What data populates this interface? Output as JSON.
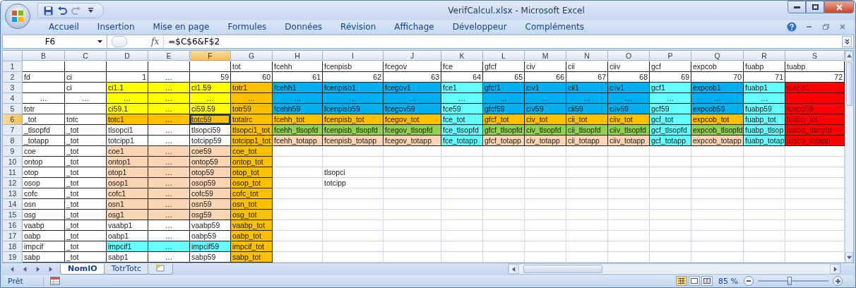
{
  "window": {
    "title": "VerifCalcul.xlsx - Microsoft Excel"
  },
  "ribbon_tabs": [
    {
      "label": "Accueil",
      "selected": false
    },
    {
      "label": "Insertion",
      "selected": false
    },
    {
      "label": "Mise en page",
      "selected": false
    },
    {
      "label": "Formules",
      "selected": false
    },
    {
      "label": "Données",
      "selected": false
    },
    {
      "label": "Révision",
      "selected": false
    },
    {
      "label": "Affichage",
      "selected": false
    },
    {
      "label": "Développeur",
      "selected": false
    },
    {
      "label": "Compléments",
      "selected": false
    }
  ],
  "formula_bar": {
    "name_box": "F6",
    "function_label": "fx",
    "formula": "=$C$6&F$2"
  },
  "grid": {
    "columns": [
      {
        "label": "B",
        "selected": false
      },
      {
        "label": "C",
        "selected": false
      },
      {
        "label": "D",
        "selected": false
      },
      {
        "label": "E",
        "selected": false
      },
      {
        "label": "F",
        "selected": true
      },
      {
        "label": "G",
        "selected": false
      },
      {
        "label": "H",
        "selected": false
      },
      {
        "label": "I",
        "selected": false
      },
      {
        "label": "J",
        "selected": false
      },
      {
        "label": "K",
        "selected": false
      },
      {
        "label": "L",
        "selected": false
      },
      {
        "label": "M",
        "selected": false
      },
      {
        "label": "N",
        "selected": false
      },
      {
        "label": "O",
        "selected": false
      },
      {
        "label": "P",
        "selected": false
      },
      {
        "label": "Q",
        "selected": false
      },
      {
        "label": "R",
        "selected": false
      },
      {
        "label": "S",
        "selected": false
      }
    ],
    "rows": [
      {
        "number": "1",
        "selected": false,
        "cells": [
          {
            "kind": "label"
          },
          {
            "kind": "label"
          },
          {
            "kind": "label"
          },
          {
            "kind": "label"
          },
          {
            "kind": "label"
          },
          {
            "kind": "label",
            "text": "tot"
          },
          {
            "kind": "label",
            "text": "fcehh"
          },
          {
            "kind": "label",
            "text": "fcenpisb"
          },
          {
            "kind": "label",
            "text": "fcegov"
          },
          {
            "kind": "label",
            "text": "fce"
          },
          {
            "kind": "label",
            "text": "gfcf"
          },
          {
            "kind": "label",
            "text": "civ"
          },
          {
            "kind": "label",
            "text": "cii"
          },
          {
            "kind": "label",
            "text": "ciiv"
          },
          {
            "kind": "label",
            "text": "gcf"
          },
          {
            "kind": "label",
            "text": "expcob"
          },
          {
            "kind": "label",
            "text": "fuabp"
          },
          {
            "kind": "label",
            "text": "tuabp"
          }
        ]
      },
      {
        "number": "2",
        "selected": false,
        "cells": [
          {
            "kind": "label",
            "text": "fd"
          },
          {
            "kind": "label",
            "text": "ci"
          },
          {
            "kind": "number",
            "text": "1"
          },
          {
            "kind": "ellipsis",
            "text": "…"
          },
          {
            "kind": "number",
            "text": "59"
          },
          {
            "kind": "number",
            "text": "60"
          },
          {
            "kind": "number",
            "text": "61"
          },
          {
            "kind": "number",
            "text": "62"
          },
          {
            "kind": "number",
            "text": "63"
          },
          {
            "kind": "number",
            "text": "64"
          },
          {
            "kind": "number",
            "text": "65"
          },
          {
            "kind": "number",
            "text": "66"
          },
          {
            "kind": "number",
            "text": "67"
          },
          {
            "kind": "number",
            "text": "68"
          },
          {
            "kind": "number",
            "text": "69"
          },
          {
            "kind": "number",
            "text": "70"
          },
          {
            "kind": "number",
            "text": "71"
          },
          {
            "kind": "number",
            "text": "72"
          }
        ]
      },
      {
        "number": "3",
        "selected": false,
        "cells": [
          {
            "kind": "label"
          },
          {
            "kind": "label",
            "text": "ci"
          },
          {
            "kind": "label",
            "text": "ci1.1",
            "color": "#ffff00"
          },
          {
            "kind": "ellipsis",
            "text": "…",
            "color": "#ffff00"
          },
          {
            "kind": "label",
            "text": "ci1.59",
            "color": "#ffff00"
          },
          {
            "kind": "label",
            "text": "totr1",
            "color": "#ffc000"
          },
          {
            "kind": "label",
            "text": "fcehh1",
            "color": "#00b0f0"
          },
          {
            "kind": "label",
            "text": "fcenpisb1",
            "color": "#00b0f0"
          },
          {
            "kind": "label",
            "text": "fcegov1",
            "color": "#00b0f0"
          },
          {
            "kind": "label",
            "text": "fce1",
            "color": "#66ffff"
          },
          {
            "kind": "label",
            "text": "gfcf1",
            "color": "#00b0f0"
          },
          {
            "kind": "label",
            "text": "civ1",
            "color": "#00b0f0"
          },
          {
            "kind": "label",
            "text": "cii1",
            "color": "#00b0f0"
          },
          {
            "kind": "label",
            "text": "ciiv1",
            "color": "#00b0f0"
          },
          {
            "kind": "label",
            "text": "gcf1",
            "color": "#66ffff"
          },
          {
            "kind": "label",
            "text": "expcob1",
            "color": "#00b0f0"
          },
          {
            "kind": "label",
            "text": "fuabp1",
            "color": "#66ffff"
          },
          {
            "kind": "label",
            "text": "tuabp1",
            "color": "#ff0000"
          }
        ]
      },
      {
        "number": "4",
        "selected": false,
        "cells": [
          {
            "kind": "ellipsis",
            "text": "…"
          },
          {
            "kind": "ellipsis",
            "text": "…"
          },
          {
            "kind": "ellipsis",
            "text": "…",
            "color": "#ffff00"
          },
          {
            "kind": "ellipsis",
            "text": "…",
            "color": "#ffff00"
          },
          {
            "kind": "ellipsis",
            "text": "…",
            "color": "#ffff00"
          },
          {
            "kind": "ellipsis",
            "text": "…",
            "color": "#ffc000"
          },
          {
            "kind": "ellipsis",
            "text": "…",
            "color": "#00b0f0"
          },
          {
            "kind": "ellipsis",
            "text": "…",
            "color": "#00b0f0"
          },
          {
            "kind": "ellipsis",
            "text": "…",
            "color": "#00b0f0"
          },
          {
            "kind": "ellipsis",
            "text": "…",
            "color": "#66ffff"
          },
          {
            "kind": "ellipsis",
            "text": "…",
            "color": "#00b0f0"
          },
          {
            "kind": "ellipsis",
            "text": "…",
            "color": "#00b0f0"
          },
          {
            "kind": "ellipsis",
            "text": "…",
            "color": "#00b0f0"
          },
          {
            "kind": "ellipsis",
            "text": "…",
            "color": "#00b0f0"
          },
          {
            "kind": "ellipsis",
            "text": "…",
            "color": "#66ffff"
          },
          {
            "kind": "ellipsis",
            "text": "…",
            "color": "#00b0f0"
          },
          {
            "kind": "ellipsis",
            "text": "…",
            "color": "#66ffff"
          },
          {
            "kind": "ellipsis",
            "text": "…",
            "color": "#ff0000"
          }
        ]
      },
      {
        "number": "5",
        "selected": false,
        "cells": [
          {
            "kind": "label",
            "text": "totr"
          },
          {
            "kind": "label"
          },
          {
            "kind": "label",
            "text": "ci59.1",
            "color": "#ffff00"
          },
          {
            "kind": "ellipsis",
            "text": "…",
            "color": "#ffff00"
          },
          {
            "kind": "label",
            "text": "ci59.59",
            "color": "#ffff00"
          },
          {
            "kind": "label",
            "text": "totr59",
            "color": "#ffc000"
          },
          {
            "kind": "label",
            "text": "fcehh59",
            "color": "#00b0f0"
          },
          {
            "kind": "label",
            "text": "fcenpisb59",
            "color": "#00b0f0"
          },
          {
            "kind": "label",
            "text": "fcegov59",
            "color": "#00b0f0"
          },
          {
            "kind": "label",
            "text": "fce59",
            "color": "#66ffff"
          },
          {
            "kind": "label",
            "text": "gfcf59",
            "color": "#00b0f0"
          },
          {
            "kind": "label",
            "text": "civ59",
            "color": "#00b0f0"
          },
          {
            "kind": "label",
            "text": "cii59",
            "color": "#00b0f0"
          },
          {
            "kind": "label",
            "text": "ciiv59",
            "color": "#00b0f0"
          },
          {
            "kind": "label",
            "text": "gcf59",
            "color": "#66ffff"
          },
          {
            "kind": "label",
            "text": "expcob59",
            "color": "#00b0f0"
          },
          {
            "kind": "label",
            "text": "fuabp59",
            "color": "#66ffff"
          },
          {
            "kind": "label",
            "text": "tuabp59",
            "color": "#ff0000"
          }
        ]
      },
      {
        "number": "6",
        "selected": true,
        "cells": [
          {
            "kind": "label",
            "text": "_tot"
          },
          {
            "kind": "label",
            "text": "totc"
          },
          {
            "kind": "label",
            "text": "totc1",
            "color": "#ffc000"
          },
          {
            "kind": "ellipsis",
            "text": "…",
            "color": "#ffc000"
          },
          {
            "kind": "label",
            "text": "totc59",
            "color": "#ffc000"
          },
          {
            "kind": "label",
            "text": "totalrc",
            "color": "#ffc000"
          },
          {
            "kind": "label",
            "text": "fcehh_tot",
            "color": "#ffc000"
          },
          {
            "kind": "label",
            "text": "fcenpisb_tot",
            "color": "#ffc000"
          },
          {
            "kind": "label",
            "text": "fcegov_tot",
            "color": "#ffc000"
          },
          {
            "kind": "label",
            "text": "fce_tot",
            "color": "#66ffff"
          },
          {
            "kind": "label",
            "text": "gfcf_tot",
            "color": "#ffc000"
          },
          {
            "kind": "label",
            "text": "civ_tot",
            "color": "#ffc000"
          },
          {
            "kind": "label",
            "text": "cii_tot",
            "color": "#ffc000"
          },
          {
            "kind": "label",
            "text": "ciiv_tot",
            "color": "#ffc000"
          },
          {
            "kind": "label",
            "text": "gcf_tot",
            "color": "#66ffff"
          },
          {
            "kind": "label",
            "text": "expcob_tot",
            "color": "#ffc000"
          },
          {
            "kind": "label",
            "text": "fuabp_tot",
            "color": "#66ffff"
          },
          {
            "kind": "label",
            "text": "tuabp_tot",
            "color": "#ff0000"
          }
        ]
      },
      {
        "number": "7",
        "selected": false,
        "cells": [
          {
            "kind": "label",
            "text": "_tlsopfd"
          },
          {
            "kind": "label",
            "text": "_tot"
          },
          {
            "kind": "label",
            "text": "tlsopci1"
          },
          {
            "kind": "ellipsis",
            "text": "…"
          },
          {
            "kind": "label",
            "text": "tlsopci59"
          },
          {
            "kind": "label",
            "text": "tlsopci1_tot",
            "color": "#ffc000"
          },
          {
            "kind": "label",
            "text": "fcehh_tlsopfd",
            "color": "#92d050"
          },
          {
            "kind": "label",
            "text": "fcenpisb_tlsopfd",
            "color": "#92d050"
          },
          {
            "kind": "label",
            "text": "fcegov_tlsopfd",
            "color": "#92d050"
          },
          {
            "kind": "label",
            "text": "fce_tlsopfd",
            "color": "#66ffff"
          },
          {
            "kind": "label",
            "text": "gfcf_tlsopfd",
            "color": "#92d050"
          },
          {
            "kind": "label",
            "text": "civ_tlsopfd",
            "color": "#92d050"
          },
          {
            "kind": "label",
            "text": "cii_tlsopfd",
            "color": "#92d050"
          },
          {
            "kind": "label",
            "text": "ciiv_tlsopfd",
            "color": "#92d050"
          },
          {
            "kind": "label",
            "text": "gcf_tlsopfd",
            "color": "#66ffff"
          },
          {
            "kind": "label",
            "text": "expcob_tlsopfd",
            "color": "#92d050"
          },
          {
            "kind": "label",
            "text": "fuabp_tlsop",
            "color": "#66ffff"
          },
          {
            "kind": "label",
            "text": "tuabp_tlsopfd",
            "color": "#ff0000"
          }
        ]
      },
      {
        "number": "8",
        "selected": false,
        "cells": [
          {
            "kind": "label",
            "text": "_totapp"
          },
          {
            "kind": "label",
            "text": "_tot"
          },
          {
            "kind": "label",
            "text": "totcipp1"
          },
          {
            "kind": "ellipsis",
            "text": "…"
          },
          {
            "kind": "label",
            "text": "totcipp59"
          },
          {
            "kind": "label",
            "text": "totcipp1_tot",
            "color": "#ffc000"
          },
          {
            "kind": "label",
            "text": "fcehh_totapp",
            "color": "#fcd5b4"
          },
          {
            "kind": "label",
            "text": "fcenpisb_totapp",
            "color": "#fcd5b4"
          },
          {
            "kind": "label",
            "text": "fcegov_totapp",
            "color": "#fcd5b4"
          },
          {
            "kind": "label",
            "text": "fce_totapp",
            "color": "#66ffff"
          },
          {
            "kind": "label",
            "text": "gfcf_totapp",
            "color": "#fcd5b4"
          },
          {
            "kind": "label",
            "text": "civ_totapp",
            "color": "#fcd5b4"
          },
          {
            "kind": "label",
            "text": "cii_totapp",
            "color": "#fcd5b4"
          },
          {
            "kind": "label",
            "text": "ciiv_totapp",
            "color": "#fcd5b4"
          },
          {
            "kind": "label",
            "text": "gcf_totapp",
            "color": "#66ffff"
          },
          {
            "kind": "label",
            "text": "expcob_totapp",
            "color": "#fcd5b4"
          },
          {
            "kind": "label",
            "text": "fuabp_totap",
            "color": "#66ffff"
          },
          {
            "kind": "label",
            "text": "tuabp_totapp",
            "color": "#ff0000"
          }
        ]
      },
      {
        "number": "9",
        "selected": false,
        "cells": [
          {
            "kind": "label",
            "text": "coe"
          },
          {
            "kind": "label",
            "text": "_tot"
          },
          {
            "kind": "label",
            "text": "coe1",
            "color": "#fcd5b4"
          },
          {
            "kind": "ellipsis",
            "text": "…",
            "color": "#fcd5b4"
          },
          {
            "kind": "label",
            "text": "coe59",
            "color": "#fcd5b4"
          },
          {
            "kind": "label",
            "text": "coe_tot",
            "color": "#ffc000"
          },
          {
            "kind": "loose"
          },
          {
            "kind": "loose"
          },
          {
            "kind": "loose"
          },
          {
            "kind": "loose"
          },
          {
            "kind": "loose"
          },
          {
            "kind": "loose"
          },
          {
            "kind": "loose"
          },
          {
            "kind": "loose"
          },
          {
            "kind": "loose"
          },
          {
            "kind": "loose"
          },
          {
            "kind": "loose"
          },
          {
            "kind": "loose"
          }
        ]
      },
      {
        "number": "10",
        "selected": false,
        "cells": [
          {
            "kind": "label",
            "text": "ontop"
          },
          {
            "kind": "label",
            "text": "_tot"
          },
          {
            "kind": "label",
            "text": "ontop1",
            "color": "#fcd5b4"
          },
          {
            "kind": "ellipsis",
            "text": "…",
            "color": "#fcd5b4"
          },
          {
            "kind": "label",
            "text": "ontop59",
            "color": "#fcd5b4"
          },
          {
            "kind": "label",
            "text": "ontop_tot",
            "color": "#ffc000"
          },
          {
            "kind": "loose"
          },
          {
            "kind": "loose"
          },
          {
            "kind": "loose"
          },
          {
            "kind": "loose"
          },
          {
            "kind": "loose"
          },
          {
            "kind": "loose"
          },
          {
            "kind": "loose"
          },
          {
            "kind": "loose"
          },
          {
            "kind": "loose"
          },
          {
            "kind": "loose"
          },
          {
            "kind": "loose"
          },
          {
            "kind": "loose"
          }
        ]
      },
      {
        "number": "11",
        "selected": false,
        "cells": [
          {
            "kind": "label",
            "text": "otop"
          },
          {
            "kind": "label",
            "text": "_tot"
          },
          {
            "kind": "label",
            "text": "otop1",
            "color": "#fcd5b4"
          },
          {
            "kind": "ellipsis",
            "text": "…",
            "color": "#fcd5b4"
          },
          {
            "kind": "label",
            "text": "otop59",
            "color": "#fcd5b4"
          },
          {
            "kind": "label",
            "text": "otop_tot",
            "color": "#ffc000"
          },
          {
            "kind": "loose"
          },
          {
            "kind": "loose",
            "text": "tlsopci"
          },
          {
            "kind": "loose"
          },
          {
            "kind": "loose"
          },
          {
            "kind": "loose"
          },
          {
            "kind": "loose"
          },
          {
            "kind": "loose"
          },
          {
            "kind": "loose"
          },
          {
            "kind": "loose"
          },
          {
            "kind": "loose"
          },
          {
            "kind": "loose"
          },
          {
            "kind": "loose"
          }
        ]
      },
      {
        "number": "12",
        "selected": false,
        "cells": [
          {
            "kind": "label",
            "text": "osop"
          },
          {
            "kind": "label",
            "text": "_tot"
          },
          {
            "kind": "label",
            "text": "osop1",
            "color": "#fcd5b4"
          },
          {
            "kind": "ellipsis",
            "text": "…",
            "color": "#fcd5b4"
          },
          {
            "kind": "label",
            "text": "osop59",
            "color": "#fcd5b4"
          },
          {
            "kind": "label",
            "text": "osop_tot",
            "color": "#ffc000"
          },
          {
            "kind": "loose"
          },
          {
            "kind": "loose",
            "text": "totcipp"
          },
          {
            "kind": "loose"
          },
          {
            "kind": "loose"
          },
          {
            "kind": "loose"
          },
          {
            "kind": "loose"
          },
          {
            "kind": "loose"
          },
          {
            "kind": "loose"
          },
          {
            "kind": "loose"
          },
          {
            "kind": "loose"
          },
          {
            "kind": "loose"
          },
          {
            "kind": "loose"
          }
        ]
      },
      {
        "number": "13",
        "selected": false,
        "cells": [
          {
            "kind": "label",
            "text": "cofc"
          },
          {
            "kind": "label",
            "text": "_tot"
          },
          {
            "kind": "label",
            "text": "cofc1",
            "color": "#fcd5b4"
          },
          {
            "kind": "ellipsis",
            "text": "…",
            "color": "#fcd5b4"
          },
          {
            "kind": "label",
            "text": "cofc59",
            "color": "#fcd5b4"
          },
          {
            "kind": "label",
            "text": "cofc_tot",
            "color": "#ffc000"
          },
          {
            "kind": "loose"
          },
          {
            "kind": "loose"
          },
          {
            "kind": "loose"
          },
          {
            "kind": "loose"
          },
          {
            "kind": "loose"
          },
          {
            "kind": "loose"
          },
          {
            "kind": "loose"
          },
          {
            "kind": "loose"
          },
          {
            "kind": "loose"
          },
          {
            "kind": "loose"
          },
          {
            "kind": "loose"
          },
          {
            "kind": "loose"
          }
        ]
      },
      {
        "number": "14",
        "selected": false,
        "cells": [
          {
            "kind": "label",
            "text": "osn"
          },
          {
            "kind": "label",
            "text": "_tot"
          },
          {
            "kind": "label",
            "text": "osn1",
            "color": "#fcd5b4"
          },
          {
            "kind": "ellipsis",
            "text": "…",
            "color": "#fcd5b4"
          },
          {
            "kind": "label",
            "text": "osn59",
            "color": "#fcd5b4"
          },
          {
            "kind": "label",
            "text": "osn_tot",
            "color": "#ffc000"
          },
          {
            "kind": "loose"
          },
          {
            "kind": "loose"
          },
          {
            "kind": "loose"
          },
          {
            "kind": "loose"
          },
          {
            "kind": "loose"
          },
          {
            "kind": "loose"
          },
          {
            "kind": "loose"
          },
          {
            "kind": "loose"
          },
          {
            "kind": "loose"
          },
          {
            "kind": "loose"
          },
          {
            "kind": "loose"
          },
          {
            "kind": "loose"
          }
        ]
      },
      {
        "number": "15",
        "selected": false,
        "cells": [
          {
            "kind": "label",
            "text": "osg"
          },
          {
            "kind": "label",
            "text": "_tot"
          },
          {
            "kind": "label",
            "text": "osg1",
            "color": "#fcd5b4"
          },
          {
            "kind": "ellipsis",
            "text": "…",
            "color": "#fcd5b4"
          },
          {
            "kind": "label",
            "text": "osg59",
            "color": "#fcd5b4"
          },
          {
            "kind": "label",
            "text": "osg_tot",
            "color": "#ffc000"
          },
          {
            "kind": "loose"
          },
          {
            "kind": "loose"
          },
          {
            "kind": "loose"
          },
          {
            "kind": "loose"
          },
          {
            "kind": "loose"
          },
          {
            "kind": "loose"
          },
          {
            "kind": "loose"
          },
          {
            "kind": "loose"
          },
          {
            "kind": "loose"
          },
          {
            "kind": "loose"
          },
          {
            "kind": "loose"
          },
          {
            "kind": "loose"
          }
        ]
      },
      {
        "number": "16",
        "selected": false,
        "cells": [
          {
            "kind": "label",
            "text": "vaabp"
          },
          {
            "kind": "label",
            "text": "_tot"
          },
          {
            "kind": "label",
            "text": "vaabp1"
          },
          {
            "kind": "ellipsis",
            "text": "…"
          },
          {
            "kind": "label",
            "text": "vaabp59"
          },
          {
            "kind": "label",
            "text": "vaabp_tot",
            "color": "#ffc000"
          },
          {
            "kind": "loose"
          },
          {
            "kind": "loose"
          },
          {
            "kind": "loose"
          },
          {
            "kind": "loose"
          },
          {
            "kind": "loose"
          },
          {
            "kind": "loose"
          },
          {
            "kind": "loose"
          },
          {
            "kind": "loose"
          },
          {
            "kind": "loose"
          },
          {
            "kind": "loose"
          },
          {
            "kind": "loose"
          },
          {
            "kind": "loose"
          }
        ]
      },
      {
        "number": "17",
        "selected": false,
        "cells": [
          {
            "kind": "label",
            "text": "oabp"
          },
          {
            "kind": "label",
            "text": "_tot"
          },
          {
            "kind": "label",
            "text": "oabp1"
          },
          {
            "kind": "ellipsis",
            "text": "…"
          },
          {
            "kind": "label",
            "text": "oabp59"
          },
          {
            "kind": "label",
            "text": "oabp_tot",
            "color": "#ffc000"
          },
          {
            "kind": "loose"
          },
          {
            "kind": "loose"
          },
          {
            "kind": "loose"
          },
          {
            "kind": "loose"
          },
          {
            "kind": "loose"
          },
          {
            "kind": "loose"
          },
          {
            "kind": "loose"
          },
          {
            "kind": "loose"
          },
          {
            "kind": "loose"
          },
          {
            "kind": "loose"
          },
          {
            "kind": "loose"
          },
          {
            "kind": "loose"
          }
        ]
      },
      {
        "number": "18",
        "selected": false,
        "cells": [
          {
            "kind": "label",
            "text": "impcif"
          },
          {
            "kind": "label",
            "text": "_tot"
          },
          {
            "kind": "label",
            "text": "impcif1",
            "color": "#66ffff"
          },
          {
            "kind": "ellipsis",
            "text": "…",
            "color": "#66ffff"
          },
          {
            "kind": "label",
            "text": "impcif59",
            "color": "#66ffff"
          },
          {
            "kind": "label",
            "text": "impcif_tot",
            "color": "#ffc000"
          },
          {
            "kind": "loose"
          },
          {
            "kind": "loose"
          },
          {
            "kind": "loose"
          },
          {
            "kind": "loose"
          },
          {
            "kind": "loose"
          },
          {
            "kind": "loose"
          },
          {
            "kind": "loose"
          },
          {
            "kind": "loose"
          },
          {
            "kind": "loose"
          },
          {
            "kind": "loose"
          },
          {
            "kind": "loose"
          },
          {
            "kind": "loose"
          }
        ]
      },
      {
        "number": "19",
        "selected": false,
        "cells": [
          {
            "kind": "label",
            "text": "sabp"
          },
          {
            "kind": "label",
            "text": "_tot"
          },
          {
            "kind": "label",
            "text": "sabp1"
          },
          {
            "kind": "ellipsis",
            "text": "…"
          },
          {
            "kind": "label",
            "text": "sabp59"
          },
          {
            "kind": "label",
            "text": "sabp_tot",
            "color": "#ffc000"
          },
          {
            "kind": "loose"
          },
          {
            "kind": "loose"
          },
          {
            "kind": "loose"
          },
          {
            "kind": "loose"
          },
          {
            "kind": "loose"
          },
          {
            "kind": "loose"
          },
          {
            "kind": "loose"
          },
          {
            "kind": "loose"
          },
          {
            "kind": "loose"
          },
          {
            "kind": "loose"
          },
          {
            "kind": "loose"
          },
          {
            "kind": "loose"
          }
        ]
      }
    ]
  },
  "sheet_tabs": [
    {
      "label": "NomIO",
      "selected": true
    },
    {
      "label": "TotrTotc",
      "selected": false
    }
  ],
  "status_bar": {
    "status": "Prêt",
    "zoom": {
      "reading": "85 %",
      "level": 0.45
    }
  }
}
